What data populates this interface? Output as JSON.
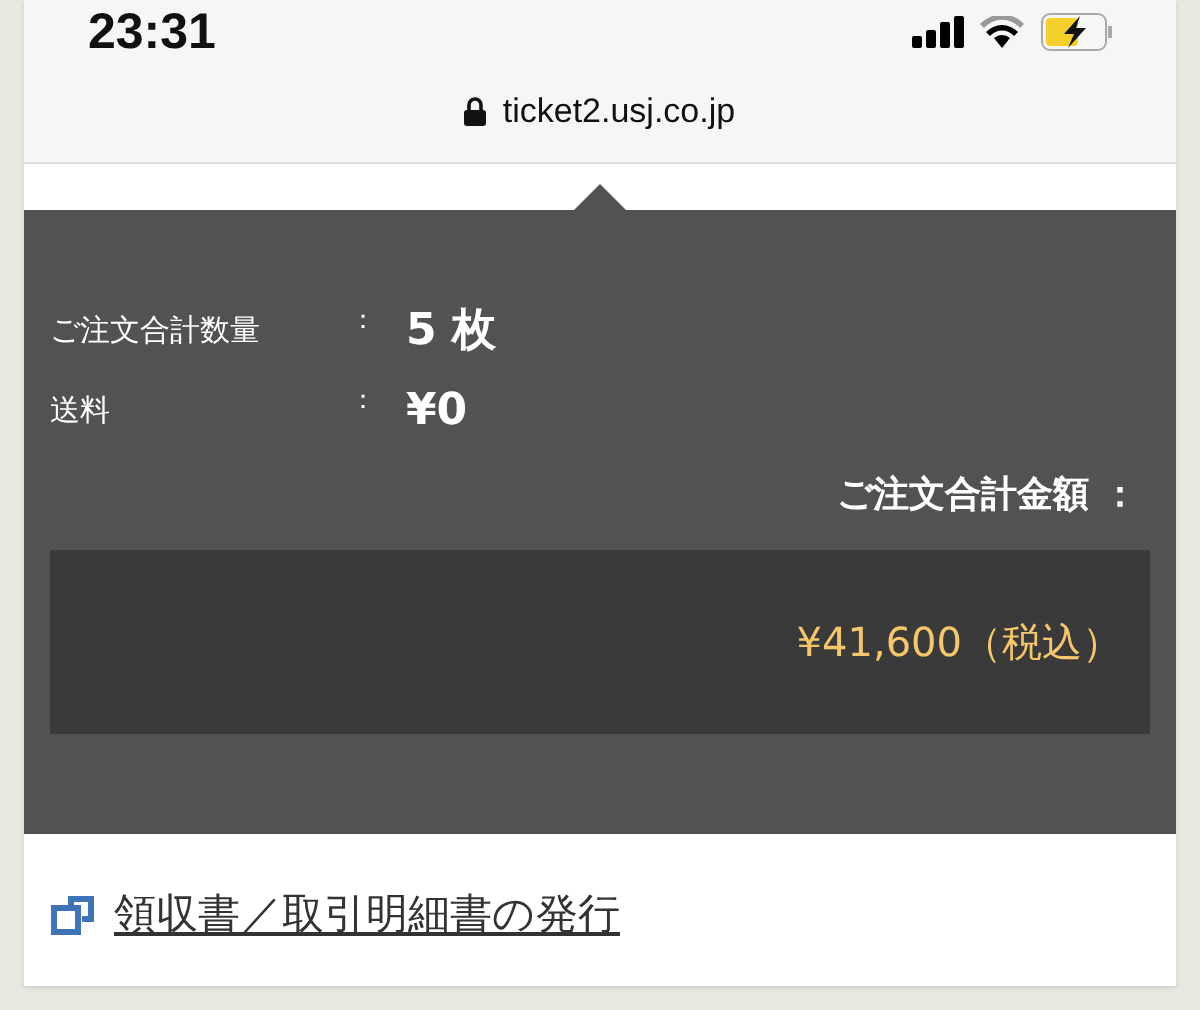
{
  "status_bar": {
    "time": "23:31"
  },
  "address_bar": {
    "url": "ticket2.usj.co.jp"
  },
  "summary": {
    "rows": [
      {
        "label": "ご注文合計数量",
        "separator": "：",
        "value": "5 枚"
      },
      {
        "label": "送料",
        "separator": "：",
        "value": "¥0"
      }
    ],
    "total_label": "ご注文合計金額 ：",
    "total_value": "¥41,600（税込）"
  },
  "receipt_link": {
    "label": "領収書／取引明細書の発行"
  }
}
